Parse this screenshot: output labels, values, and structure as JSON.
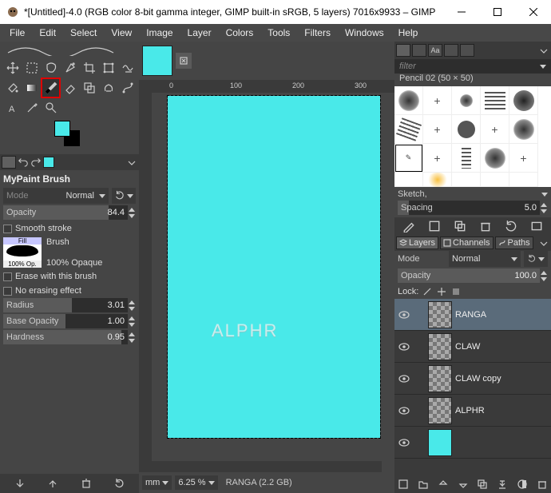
{
  "title": "*[Untitled]-4.0 (RGB color 8-bit gamma integer, GIMP built-in sRGB, 5 layers) 7016x9933 – GIMP",
  "menus": [
    "File",
    "Edit",
    "Select",
    "View",
    "Image",
    "Layer",
    "Colors",
    "Tools",
    "Filters",
    "Windows",
    "Help"
  ],
  "tool_options": {
    "title": "MyPaint Brush",
    "mode_label": "Mode",
    "mode_value": "Normal",
    "opacity_label": "Opacity",
    "opacity_value": "84.4",
    "smooth_label": "Smooth stroke",
    "brush_section_label": "Brush",
    "brush_thumb_fill": "Fill",
    "brush_thumb_opacity": "100% Op.",
    "brush_name": "100% Opaque",
    "erase_label": "Erase with this brush",
    "noerase_label": "No erasing effect",
    "radius_label": "Radius",
    "radius_value": "3.01",
    "baseop_label": "Base Opacity",
    "baseop_value": "1.00",
    "hardness_label": "Hardness",
    "hardness_value": "0.95"
  },
  "ruler_ticks": [
    "0",
    "100",
    "200",
    "300"
  ],
  "canvas_watermark": "ALPHR",
  "status": {
    "unit": "mm",
    "zoom": "6.25 %",
    "message": "RANGA (2.2 GB)"
  },
  "brushes": {
    "filter_placeholder": "filter",
    "name_line": "Pencil 02 (50 × 50)",
    "sketch_label": "Sketch,",
    "spacing_label": "Spacing",
    "spacing_value": "5.0"
  },
  "layers": {
    "tab_layers": "Layers",
    "tab_channels": "Channels",
    "tab_paths": "Paths",
    "mode_label": "Mode",
    "mode_value": "Normal",
    "opacity_label": "Opacity",
    "opacity_value": "100.0",
    "lock_label": "Lock:",
    "items": [
      {
        "name": "RANGA",
        "visible": true,
        "selected": true,
        "cyan": false
      },
      {
        "name": "CLAW",
        "visible": true,
        "selected": false,
        "cyan": false
      },
      {
        "name": "CLAW copy",
        "visible": true,
        "selected": false,
        "cyan": false
      },
      {
        "name": "ALPHR",
        "visible": true,
        "selected": false,
        "cyan": false
      },
      {
        "name": "",
        "visible": true,
        "selected": false,
        "cyan": true
      }
    ]
  },
  "colors": {
    "fg": "#49e9e9",
    "bg": "#000000",
    "canvas": "#49e9e9"
  }
}
